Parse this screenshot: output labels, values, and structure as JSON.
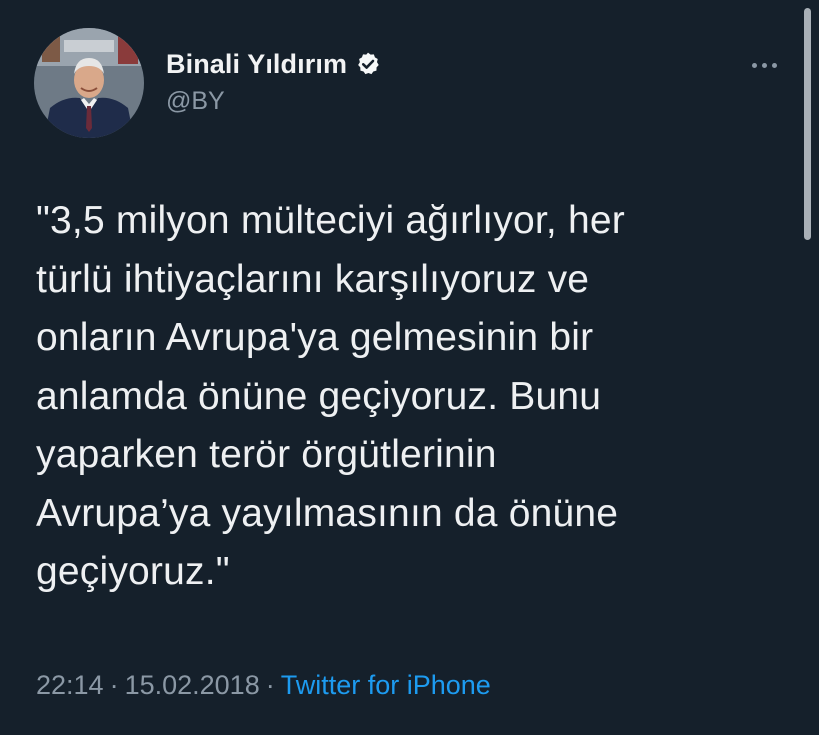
{
  "tweet": {
    "author": {
      "display_name": "Binali Yıldırım",
      "handle": "@BY",
      "verified": true,
      "avatar_icon": "profile-photo"
    },
    "more_icon": "more-horizontal-icon",
    "text": "\"3,5 milyon mülteciyi ağırlıyor, her\ntürlü ihtiyaçlarını karşılıyoruz ve\nonların Avrupa'ya gelmesinin bir\nanlamda önüne geçiyoruz. Bunu\nyaparken terör örgütlerinin\nAvrupa’ya yayılmasının da önüne\ngeçiyoruz.\"",
    "time": "22:14",
    "date": "15.02.2018",
    "separator": "·",
    "source": "Twitter for iPhone"
  },
  "colors": {
    "background": "#15202b",
    "text": "#e7e9ea",
    "secondary_text": "#8b98a5",
    "link": "#1d9bf0"
  }
}
